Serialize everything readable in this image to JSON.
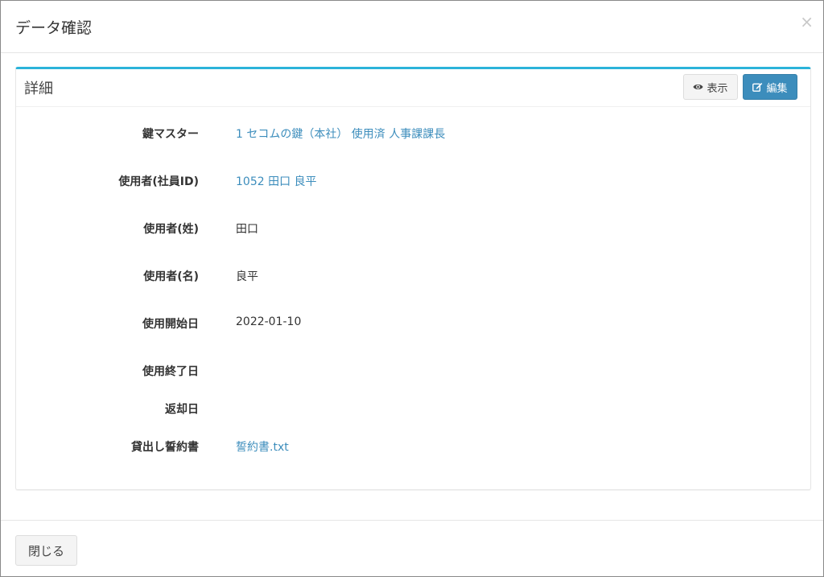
{
  "modal": {
    "title": "データ確認",
    "close_glyph": "×"
  },
  "panel": {
    "title": "詳細",
    "view_button": "表示",
    "edit_button": "編集",
    "view_icon": "eye-icon",
    "edit_icon": "edit-icon",
    "accent_color": "#2bb3d9"
  },
  "fields": [
    {
      "label": "鍵マスター",
      "value": "1 セコムの鍵（本社） 使用済 人事課課長",
      "link": true
    },
    {
      "label": "使用者(社員ID)",
      "value": "1052 田口 良平",
      "link": true
    },
    {
      "label": "使用者(姓)",
      "value": "田口",
      "link": false
    },
    {
      "label": "使用者(名)",
      "value": "良平",
      "link": false
    },
    {
      "label": "使用開始日",
      "value": "2022-01-10",
      "link": false
    },
    {
      "label": "使用終了日",
      "value": "",
      "link": false
    },
    {
      "label": "返却日",
      "value": "",
      "link": false
    },
    {
      "label": "貸出し誓約書",
      "value": "誓約書.txt",
      "link": true
    }
  ],
  "footer": {
    "close_button": "閉じる"
  }
}
